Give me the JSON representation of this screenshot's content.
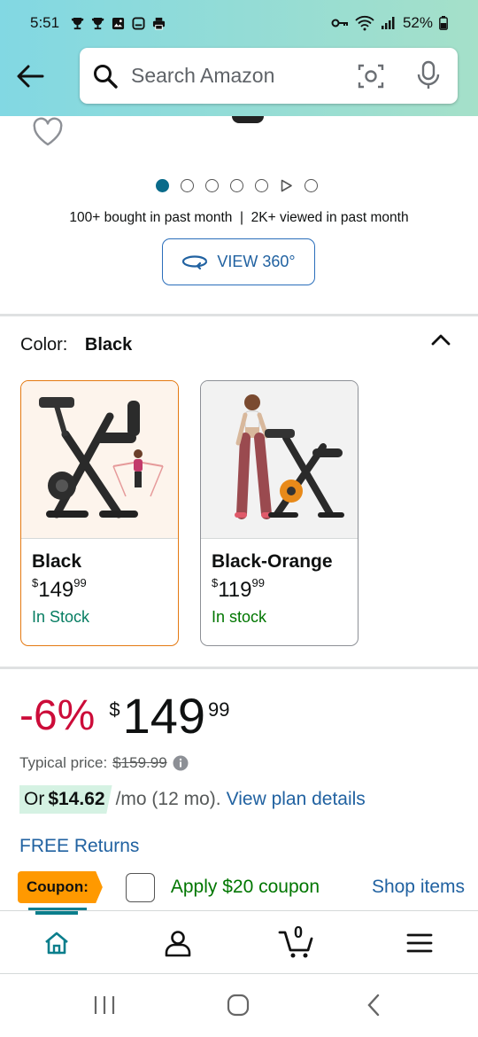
{
  "status_bar": {
    "time": "5:51",
    "battery": "52%",
    "left_icons": [
      "trophy-icon",
      "trophy-icon",
      "image-icon",
      "voicemail-icon",
      "print-icon"
    ],
    "right_icons": [
      "key-icon",
      "wifi-icon",
      "signal-icon",
      "battery-icon"
    ]
  },
  "search": {
    "placeholder": "Search Amazon"
  },
  "carousel": {
    "dot_count": 6,
    "active_index": 0,
    "has_video": true
  },
  "social_proof": "100+ bought in past month  |  2K+ viewed in past month",
  "view360_label": "VIEW 360°",
  "color_selector": {
    "label": "Color:",
    "value": "Black",
    "options": [
      {
        "name": "Black",
        "price_symbol": "$",
        "price_whole": "149",
        "price_fraction": "99",
        "stock": "In Stock",
        "selected": true
      },
      {
        "name": "Black-Orange",
        "price_symbol": "$",
        "price_whole": "119",
        "price_fraction": "99",
        "stock": "In stock",
        "selected": false
      }
    ]
  },
  "pricing": {
    "discount": "-6%",
    "currency": "$",
    "whole": "149",
    "fraction": "99",
    "typical_label": "Typical price:",
    "typical_value": "$159.99",
    "monthly_prefix": "Or",
    "monthly_amount": "$14.62",
    "monthly_suffix": "/mo (12 mo).",
    "plan_link": "View plan details",
    "free_returns": "FREE Returns"
  },
  "coupon": {
    "badge": "Coupon:",
    "apply_label": "Apply $20 coupon",
    "shop_label": "Shop items"
  },
  "bottom_nav": {
    "cart_count": "0",
    "items": [
      "home-icon",
      "account-icon",
      "cart-icon",
      "menu-icon"
    ]
  },
  "colors": {
    "accent_teal": "#0a6b8a",
    "link_blue": "#2162a1",
    "deal_red": "#cc0c39",
    "stock_green": "#067d62",
    "coupon_orange": "#ff9900",
    "selected_border": "#e47911"
  }
}
